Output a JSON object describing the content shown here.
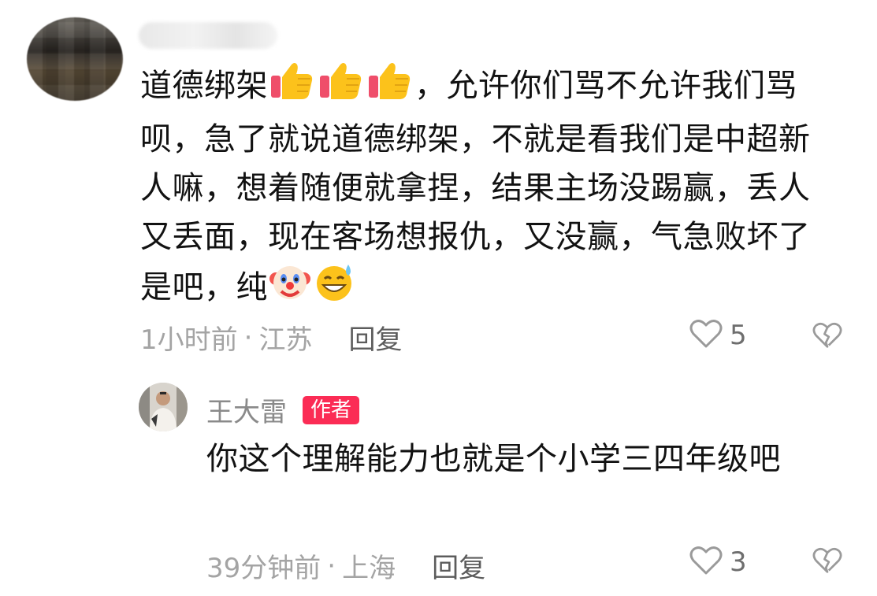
{
  "comment": {
    "text_parts": {
      "p1": "道德绑架",
      "p2": "，允许你们骂不允许我们骂呗，急了就说道德绑架，不就是看我们是中超新人嘛，想着随便就拿捏，结果主场没踢赢，丢人又丢面，现在客场想报仇，又没赢，气急败坏了是吧，纯"
    },
    "emojis_after_p1": [
      "thumbs-up-icon",
      "thumbs-up-icon",
      "thumbs-up-icon"
    ],
    "emojis_after_p2": [
      "clown-face-icon",
      "grinning-sweat-face-icon"
    ],
    "time": "1小时前",
    "separator": "·",
    "location": "江苏",
    "reply_label": "回复",
    "like_count": "5"
  },
  "reply": {
    "username": "王大雷",
    "badge": "作者",
    "text": "你这个理解能力也就是个小学三四年级吧",
    "time": "39分钟前",
    "separator": "·",
    "location": "上海",
    "reply_label": "回复",
    "like_count": "3"
  },
  "colors": {
    "badge_bg": "#fb2c55",
    "meta_gray": "#a4a4a4",
    "text": "#121212"
  }
}
